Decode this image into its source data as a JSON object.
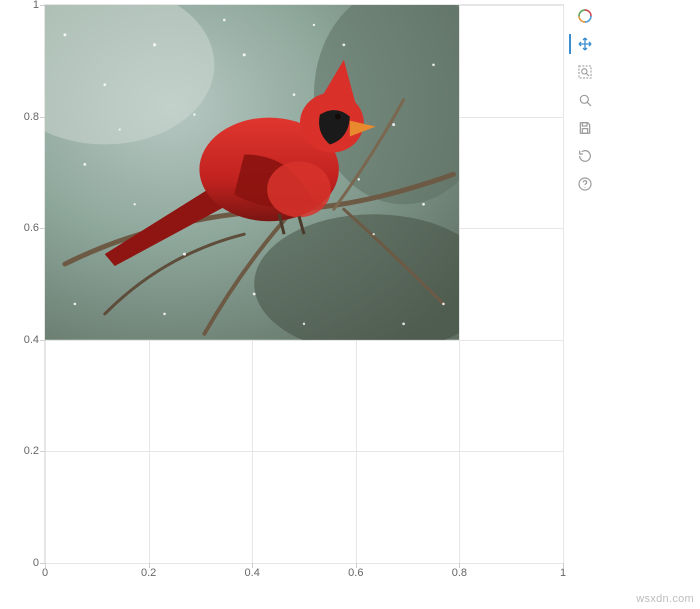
{
  "chart_data": {
    "type": "scatter",
    "title": "",
    "xlabel": "",
    "ylabel": "",
    "xlim": [
      0,
      1
    ],
    "ylim": [
      0,
      1
    ],
    "xticks": [
      0,
      0.2,
      0.4,
      0.6,
      0.8,
      1
    ],
    "yticks": [
      0,
      0.2,
      0.4,
      0.6,
      0.8,
      1
    ],
    "xtick_labels": [
      "0",
      "0.2",
      "0.4",
      "0.6",
      "0.8",
      "1"
    ],
    "ytick_labels": [
      "0",
      "0.2",
      "0.4",
      "0.6",
      "0.8",
      "1"
    ],
    "grid": true,
    "image_glyph": {
      "x_range": [
        0,
        0.8
      ],
      "y_range": [
        0.4,
        1.0
      ],
      "subject": "red northern cardinal bird on a bare branch, falling snow, blurred green-grey background"
    }
  },
  "toolbar": {
    "logo": "Bokeh",
    "items": [
      {
        "name": "pan",
        "label": "Pan",
        "active": true
      },
      {
        "name": "box_zoom",
        "label": "Box Zoom",
        "active": false
      },
      {
        "name": "wheel_zoom",
        "label": "Wheel Zoom",
        "active": false
      },
      {
        "name": "save",
        "label": "Save",
        "active": false
      },
      {
        "name": "reset",
        "label": "Reset",
        "active": false
      },
      {
        "name": "help",
        "label": "Help",
        "active": false
      }
    ]
  },
  "watermark": "wsxdn.com"
}
